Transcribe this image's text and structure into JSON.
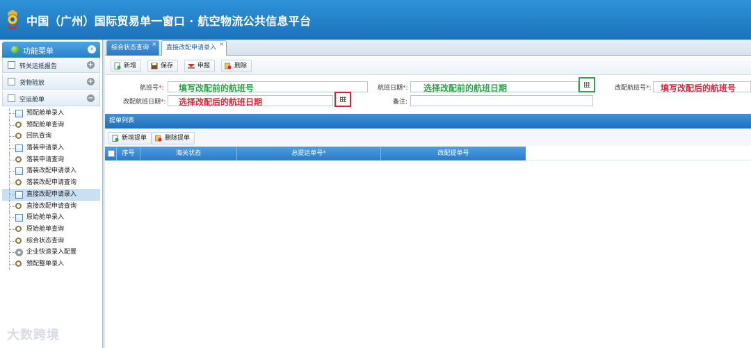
{
  "header": {
    "title": "中国（广州）国际贸易单一窗口 · 航空物流公共信息平台"
  },
  "sidebar": {
    "menu_title": "功能菜单",
    "groups": [
      {
        "label": "转关运抵报告"
      },
      {
        "label": "货物验放"
      },
      {
        "label": "空运舱单"
      }
    ],
    "items": [
      {
        "label": "预配舱单录入",
        "icon": "form-icon"
      },
      {
        "label": "预配舱单查询",
        "icon": "search-icon"
      },
      {
        "label": "回执查询",
        "icon": "search-icon"
      },
      {
        "label": "落装申请录入",
        "icon": "form-icon"
      },
      {
        "label": "落装申请查询",
        "icon": "search-icon"
      },
      {
        "label": "落装改配申请录入",
        "icon": "form-icon"
      },
      {
        "label": "落装改配申请查询",
        "icon": "search-icon"
      },
      {
        "label": "直接改配申请录入",
        "icon": "form-icon"
      },
      {
        "label": "直接改配申请查询",
        "icon": "search-icon"
      },
      {
        "label": "原始舱单录入",
        "icon": "form-icon"
      },
      {
        "label": "原始舱单查询",
        "icon": "search-icon"
      },
      {
        "label": "综合状态查询",
        "icon": "search-icon"
      },
      {
        "label": "企业快速录入配置",
        "icon": "gear-icon"
      },
      {
        "label": "预配整单录入",
        "icon": "search-icon"
      }
    ],
    "active_index": 7
  },
  "tabs": [
    {
      "label": "综合状态查询",
      "close": "×"
    },
    {
      "label": "直接改配申请录入",
      "close": "×"
    }
  ],
  "toolbar": {
    "new": "新增",
    "save": "保存",
    "declare": "申报",
    "delete": "删除"
  },
  "form": {
    "flight_no_label": "航班号",
    "flight_date_label": "航班日期",
    "new_flight_no_label": "改配航班号",
    "new_flight_date_label": "改配航班日期",
    "remark_label": "备注",
    "required_mark": "*",
    "colon": ":",
    "hint_flight_no": "填写改配前的航班号",
    "hint_flight_date": "选择改配前的航班日期",
    "hint_new_flight_no": "填写改配后的航班号",
    "hint_new_flight_date": "选择改配后的航班日期"
  },
  "list_section": {
    "title": "提单列表",
    "add_button": "新增提单",
    "delete_button": "删除提单",
    "columns": [
      "序号",
      "海关状态",
      "总提运单号",
      "改配提单号"
    ],
    "required_column_mark": "*"
  },
  "watermark": "大数跨境",
  "colors": {
    "header": "#1b72bb",
    "hint_green": "#29a847",
    "hint_red": "#e0283a"
  }
}
